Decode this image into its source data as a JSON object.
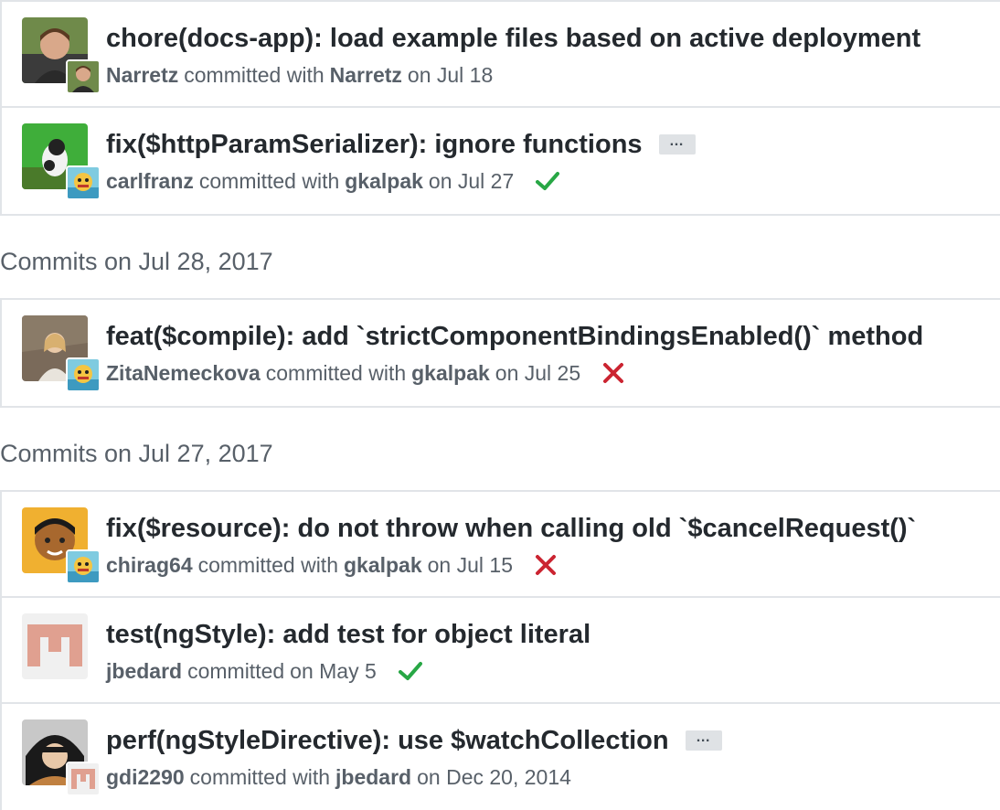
{
  "colors": {
    "success": "#28a745",
    "failure": "#cb2431",
    "border": "#e1e4e8",
    "meta_text": "#586069",
    "title_text": "#24292e"
  },
  "groups": [
    {
      "header": "",
      "commits": [
        {
          "title": "chore(docs-app): load example files based on active deployment",
          "author": "Narretz",
          "committed_text": "committed with",
          "committer": "Narretz",
          "date_text": "on Jul 18",
          "has_ellipsis": false,
          "status": "none",
          "avatar_icon": "user-photo-avatar",
          "mini_avatar_icon": "user-photo-avatar"
        },
        {
          "title": "fix($httpParamSerializer): ignore functions",
          "author": "carlfranz",
          "committed_text": "committed with",
          "committer": "gkalpak",
          "date_text": "on Jul 27",
          "has_ellipsis": true,
          "ellipsis_label": "…",
          "status": "success",
          "avatar_icon": "user-photo-avatar",
          "mini_avatar_icon": "cartoon-avatar"
        }
      ]
    },
    {
      "header": "Commits on Jul 28, 2017",
      "commits": [
        {
          "title": "feat($compile): add `strictComponentBindingsEnabled()` method",
          "author": "ZitaNemeckova",
          "committed_text": "committed with",
          "committer": "gkalpak",
          "date_text": "on Jul 25",
          "has_ellipsis": false,
          "status": "failure",
          "avatar_icon": "user-photo-avatar",
          "mini_avatar_icon": "cartoon-avatar"
        }
      ]
    },
    {
      "header": "Commits on Jul 27, 2017",
      "commits": [
        {
          "title": "fix($resource): do not throw when calling old `$cancelRequest()`",
          "author": "chirag64",
          "committed_text": "committed with",
          "committer": "gkalpak",
          "date_text": "on Jul 15",
          "has_ellipsis": false,
          "status": "failure",
          "avatar_icon": "user-photo-avatar",
          "mini_avatar_icon": "cartoon-avatar"
        },
        {
          "title": "test(ngStyle): add test for object literal",
          "author": "jbedard",
          "committed_text": "committed",
          "committer": "",
          "date_text": "on May 5",
          "has_ellipsis": false,
          "status": "success",
          "avatar_icon": "identicon-avatar",
          "mini_avatar_icon": ""
        },
        {
          "title": "perf(ngStyleDirective): use $watchCollection",
          "author": "gdi2290",
          "committed_text": "committed with",
          "committer": "jbedard",
          "date_text": "on Dec 20, 2014",
          "has_ellipsis": true,
          "ellipsis_label": "…",
          "status": "none",
          "avatar_icon": "user-photo-avatar",
          "mini_avatar_icon": "identicon-avatar"
        }
      ]
    }
  ]
}
